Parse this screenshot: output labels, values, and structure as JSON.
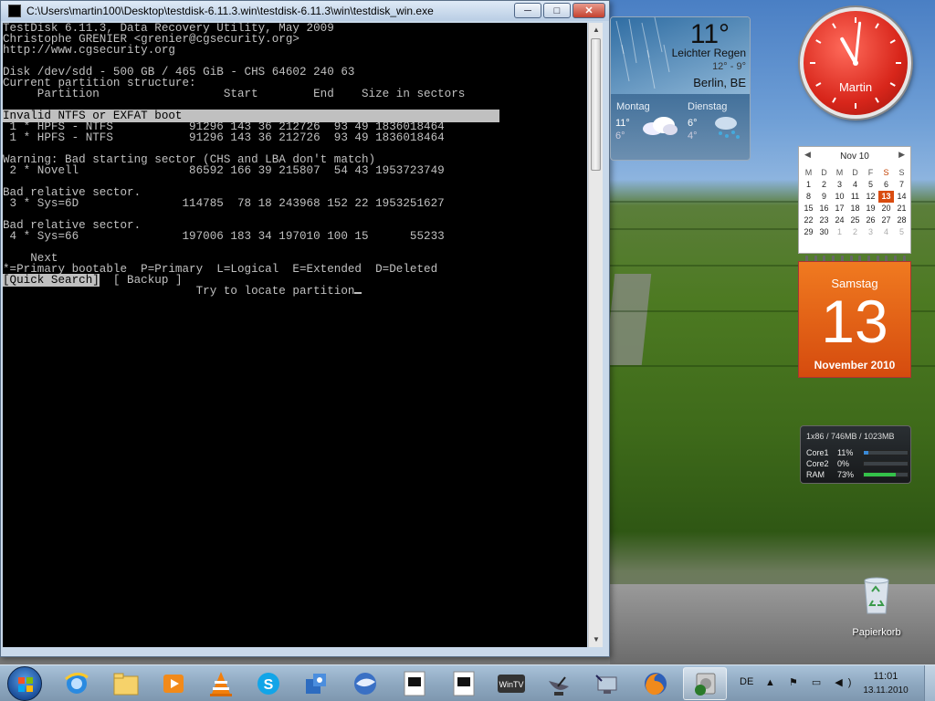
{
  "window": {
    "title": "C:\\Users\\martin100\\Desktop\\testdisk-6.11.3.win\\testdisk-6.11.3\\win\\testdisk_win.exe",
    "minimize": "─",
    "maximize": "□",
    "close": "✕"
  },
  "console": {
    "line01": "TestDisk 6.11.3, Data Recovery Utility, May 2009",
    "line02": "Christophe GRENIER <grenier@cgsecurity.org>",
    "line03": "http://www.cgsecurity.org",
    "line05": "Disk /dev/sdd - 500 GB / 465 GiB - CHS 64602 240 63",
    "line06": "Current partition structure:",
    "line07": "     Partition                  Start        End    Size in sectors",
    "line09": "Invalid NTFS or EXFAT boot                                              ",
    "line10": " 1 * HPFS - NTFS           91296 143 36 212726  93 49 1836018464",
    "line11": " 1 * HPFS - NTFS           91296 143 36 212726  93 49 1836018464",
    "line13": "Warning: Bad starting sector (CHS and LBA don't match)",
    "line14": " 2 * Novell                86592 166 39 215807  54 43 1953723749",
    "line16": "Bad relative sector.",
    "line17": " 3 * Sys=6D               114785  78 18 243968 152 22 1953251627",
    "line19": "Bad relative sector.",
    "line20": " 4 * Sys=66               197006 183 34 197010 100 15      55233",
    "line22": "    Next",
    "line23": "*=Primary bootable  P=Primary  L=Logical  E=Extended  D=Deleted",
    "menu_selected": "[Quick Search]",
    "menu_backup": "  [ Backup ]",
    "line25": "                            Try to locate partition"
  },
  "weather": {
    "temp": "11°",
    "condition": "Leichter Regen",
    "range": "12° - 9°",
    "city": "Berlin, BE",
    "day1": {
      "name": "Montag",
      "hi": "11°",
      "lo": "6°"
    },
    "day2": {
      "name": "Dienstag",
      "hi": "6°",
      "lo": "4°"
    }
  },
  "clock": {
    "name": "Martin",
    "hour": 11,
    "minute": 1
  },
  "calendar": {
    "title": "Nov 10",
    "prev": "◀",
    "next": "▶",
    "headers": [
      "M",
      "D",
      "M",
      "D",
      "F",
      "S",
      "S"
    ],
    "rows": [
      [
        "1",
        "2",
        "3",
        "4",
        "5",
        "6",
        "7"
      ],
      [
        "8",
        "9",
        "10",
        "11",
        "12",
        "13",
        "14"
      ],
      [
        "15",
        "16",
        "17",
        "18",
        "19",
        "20",
        "21"
      ],
      [
        "22",
        "23",
        "24",
        "25",
        "26",
        "27",
        "28"
      ],
      [
        "29",
        "30",
        "1",
        "2",
        "3",
        "4",
        "5"
      ]
    ],
    "today": "13",
    "weekday": "Samstag",
    "day_number": "13",
    "month_year": "November 2010"
  },
  "cpu": {
    "header": "1x86 / 746MB / 1023MB",
    "rows": [
      {
        "name": "Core1",
        "pct": "11%",
        "value": 11,
        "color": "#3a8ad8"
      },
      {
        "name": "Core2",
        "pct": "0%",
        "value": 0,
        "color": "#3a8ad8"
      },
      {
        "name": "RAM",
        "pct": "73%",
        "value": 73,
        "color": "#34c24a"
      }
    ]
  },
  "recycle": {
    "label": "Papierkorb"
  },
  "taskbar": {
    "apps": [
      "internet-explorer",
      "explorer",
      "media-center",
      "vlc",
      "skype",
      "network-sharing",
      "thunderbird",
      "console-1",
      "console-2",
      "wintv",
      "satellite",
      "remote-desktop",
      "firefox",
      "disk-utility"
    ],
    "active_app": "disk-utility",
    "lang": "DE",
    "tray": "▲ ⚑ ▭ ◀)",
    "time": "11:01",
    "date": "13.11.2010"
  }
}
